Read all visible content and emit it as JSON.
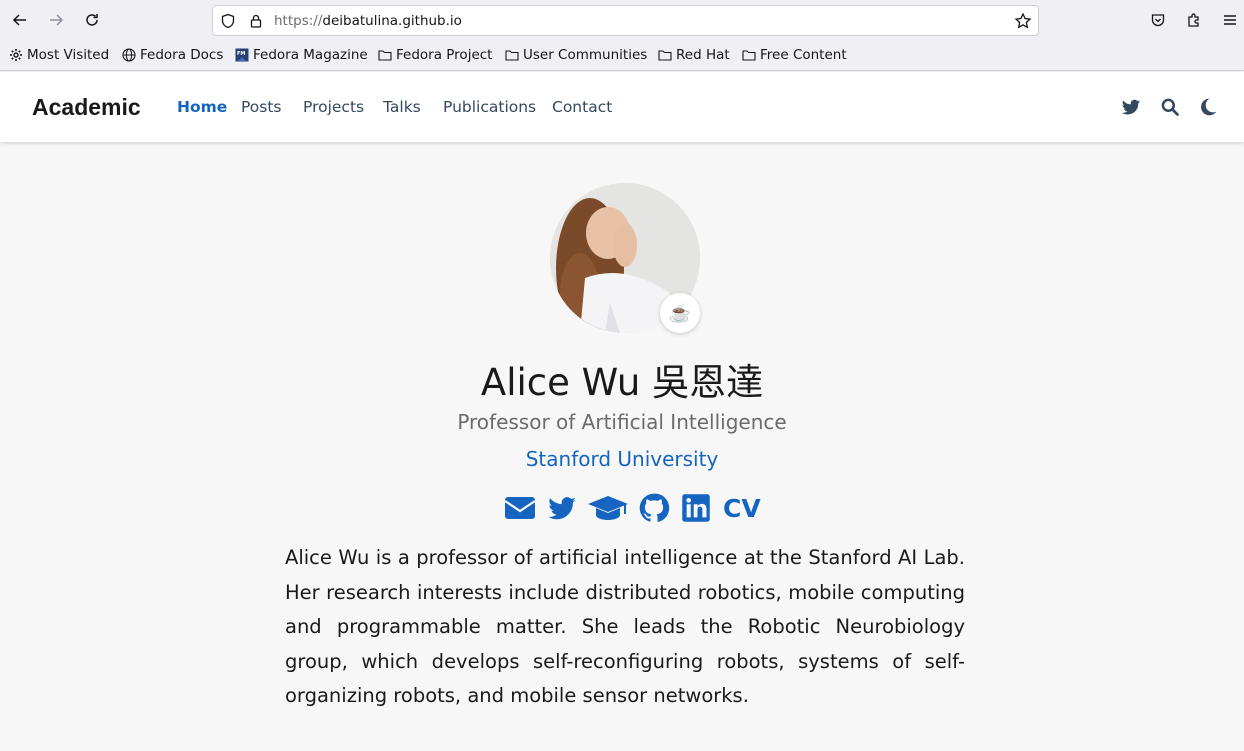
{
  "browser": {
    "url_protocol": "https://",
    "url_host": "deibatulina.github.io",
    "bookmarks": [
      {
        "label": "Most Visited",
        "icon": "gear-icon"
      },
      {
        "label": "Fedora Docs",
        "icon": "globe-icon"
      },
      {
        "label": "Fedora Magazine",
        "icon": "fm-icon"
      },
      {
        "label": "Fedora Project",
        "icon": "folder-icon"
      },
      {
        "label": "User Communities",
        "icon": "folder-icon"
      },
      {
        "label": "Red Hat",
        "icon": "folder-icon"
      },
      {
        "label": "Free Content",
        "icon": "folder-icon"
      }
    ]
  },
  "site": {
    "brand": "Academic",
    "nav": [
      "Home",
      "Posts",
      "Projects",
      "Talks",
      "Publications",
      "Contact"
    ],
    "active_nav": "Home",
    "nav_icons": [
      "twitter-icon",
      "search-icon",
      "moon-icon"
    ]
  },
  "profile": {
    "name": "Alice Wu 吳恩達",
    "role": "Professor of Artificial Intelligence",
    "organization": "Stanford University",
    "badge_emoji": "☕",
    "social_icons": [
      "envelope-icon",
      "twitter-icon",
      "graduation-cap-icon",
      "github-icon",
      "linkedin-icon"
    ],
    "cv_label": "CV",
    "bio": "Alice Wu is a professor of artificial intelligence at the Stanford AI Lab. Her research interests include distributed robotics, mobile computing and programmable matter. She leads the Robotic Neurobiology group, which develops self-reconfiguring robots, systems of self-organizing robots, and mobile sensor networks."
  },
  "colors": {
    "accent": "#1565c0",
    "page_bg": "#f7f7f7",
    "chrome_bg": "#f0f0f4"
  }
}
